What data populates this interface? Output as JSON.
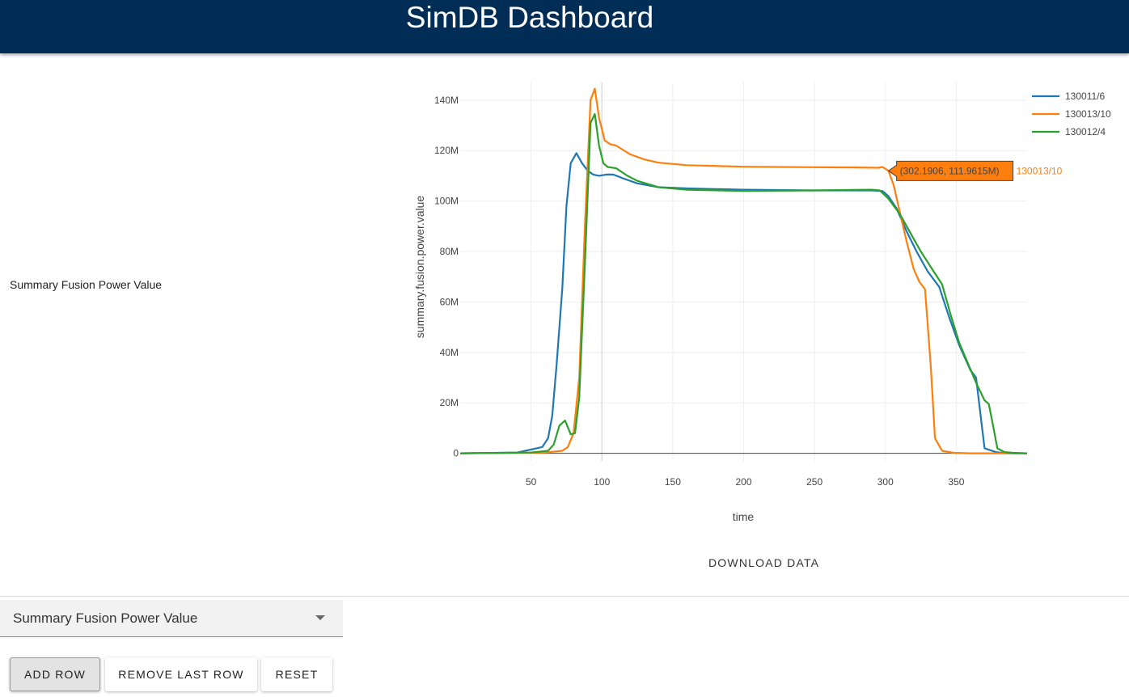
{
  "header": {
    "title": "SimDB Dashboard"
  },
  "row": {
    "label": "Summary Fusion Power Value"
  },
  "download_label": "DOWNLOAD DATA",
  "select": {
    "value": "Summary Fusion Power Value"
  },
  "buttons": {
    "add": "ADD ROW",
    "remove": "REMOVE LAST ROW",
    "reset": "RESET"
  },
  "hover": {
    "text": "(302.1906, 111.9615M)",
    "series": "130013/10",
    "x": 302.1906,
    "y": 111.9615
  },
  "chart_data": {
    "type": "line",
    "xlabel": "time",
    "ylabel": "summary.fusion.power.value",
    "xlim": [
      0,
      400
    ],
    "ylim": [
      -3,
      147
    ],
    "x_ticks": [
      50,
      100,
      150,
      200,
      250,
      300,
      350
    ],
    "x_tick_labels": [
      "50",
      "100",
      "150",
      "200",
      "250",
      "300",
      "350"
    ],
    "y_ticks": [
      0,
      20,
      40,
      60,
      80,
      100,
      120,
      140
    ],
    "y_tick_labels": [
      "0",
      "20M",
      "40M",
      "60M",
      "80M",
      "100M",
      "120M",
      "140M"
    ],
    "grid": true,
    "legend_position": "top-right",
    "series": [
      {
        "name": "130011/6",
        "color": "#1f77b4",
        "points": [
          [
            0,
            0
          ],
          [
            40,
            0.3
          ],
          [
            50,
            1.5
          ],
          [
            58,
            2.5
          ],
          [
            62,
            6
          ],
          [
            65,
            15
          ],
          [
            68,
            35
          ],
          [
            72,
            65
          ],
          [
            75,
            98
          ],
          [
            78,
            115
          ],
          [
            82,
            119
          ],
          [
            86,
            115
          ],
          [
            90,
            112
          ],
          [
            94,
            110.5
          ],
          [
            98,
            110
          ],
          [
            103,
            110.5
          ],
          [
            108,
            110.5
          ],
          [
            115,
            109
          ],
          [
            125,
            107
          ],
          [
            140,
            105.5
          ],
          [
            160,
            105
          ],
          [
            200,
            104.5
          ],
          [
            250,
            104.2
          ],
          [
            290,
            104.2
          ],
          [
            298,
            104
          ],
          [
            302,
            102
          ],
          [
            308,
            97
          ],
          [
            315,
            88
          ],
          [
            322,
            80
          ],
          [
            330,
            72
          ],
          [
            338,
            66
          ],
          [
            345,
            54
          ],
          [
            352,
            43
          ],
          [
            360,
            33
          ],
          [
            364,
            30
          ],
          [
            370,
            2
          ],
          [
            378,
            0.5
          ],
          [
            385,
            0
          ],
          [
            400,
            0
          ]
        ]
      },
      {
        "name": "130013/10",
        "color": "#ff7f0e",
        "points": [
          [
            0,
            0
          ],
          [
            60,
            0.3
          ],
          [
            72,
            1
          ],
          [
            76,
            2.5
          ],
          [
            80,
            8
          ],
          [
            84,
            30
          ],
          [
            88,
            90
          ],
          [
            92,
            140
          ],
          [
            95,
            144.5
          ],
          [
            98,
            133
          ],
          [
            102,
            124
          ],
          [
            106,
            122.5
          ],
          [
            110,
            122
          ],
          [
            120,
            118.5
          ],
          [
            130,
            116.5
          ],
          [
            140,
            115.2
          ],
          [
            160,
            114.2
          ],
          [
            200,
            113.6
          ],
          [
            250,
            113.4
          ],
          [
            280,
            113.3
          ],
          [
            295,
            113.2
          ],
          [
            298,
            113.5
          ],
          [
            302.19,
            111.96
          ],
          [
            306,
            106
          ],
          [
            310,
            96
          ],
          [
            315,
            84
          ],
          [
            320,
            73
          ],
          [
            324,
            68
          ],
          [
            328,
            65
          ],
          [
            332,
            35
          ],
          [
            335,
            6
          ],
          [
            340,
            1
          ],
          [
            348,
            0.2
          ],
          [
            360,
            0
          ],
          [
            400,
            0
          ]
        ]
      },
      {
        "name": "130012/4",
        "color": "#2ca02c",
        "points": [
          [
            0,
            0
          ],
          [
            50,
            0.3
          ],
          [
            62,
            1
          ],
          [
            66,
            3.5
          ],
          [
            70,
            11
          ],
          [
            74,
            13
          ],
          [
            78,
            7.5
          ],
          [
            81,
            8
          ],
          [
            84,
            22
          ],
          [
            88,
            75
          ],
          [
            92,
            131
          ],
          [
            95,
            134.5
          ],
          [
            98,
            122
          ],
          [
            101,
            115
          ],
          [
            104,
            113.5
          ],
          [
            110,
            113
          ],
          [
            118,
            110
          ],
          [
            125,
            108
          ],
          [
            140,
            105.5
          ],
          [
            160,
            104.5
          ],
          [
            200,
            104
          ],
          [
            250,
            104.2
          ],
          [
            290,
            104.5
          ],
          [
            296,
            104.2
          ],
          [
            302,
            101
          ],
          [
            310,
            95
          ],
          [
            318,
            87
          ],
          [
            325,
            80
          ],
          [
            333,
            73
          ],
          [
            340,
            67
          ],
          [
            346,
            55
          ],
          [
            352,
            44
          ],
          [
            358,
            36
          ],
          [
            364,
            28
          ],
          [
            370,
            21
          ],
          [
            373,
            19.5
          ],
          [
            376,
            11
          ],
          [
            379,
            2
          ],
          [
            384,
            0.5
          ],
          [
            390,
            0.2
          ],
          [
            400,
            0
          ]
        ]
      }
    ]
  }
}
